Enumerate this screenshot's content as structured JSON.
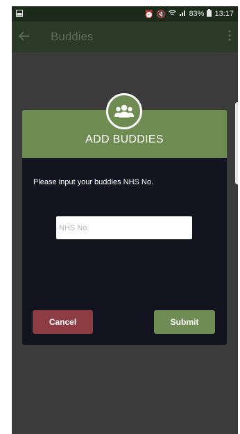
{
  "status_bar": {
    "left_icon": "image-icon",
    "battery": "83%",
    "time": "13:17",
    "icons": [
      "alarm-icon",
      "mute-icon",
      "wifi-icon",
      "signal-icon",
      "battery-icon"
    ]
  },
  "app_bar": {
    "back_icon": "arrow-back-icon",
    "title": "Buddies",
    "menu_icon": "more-vert-icon"
  },
  "dialog": {
    "icon": "group-icon",
    "title": "ADD BUDDIES",
    "prompt": "Please input your buddies NHS No.",
    "input": {
      "placeholder": "NHS No.",
      "value": ""
    },
    "cancel_label": "Cancel",
    "submit_label": "Submit"
  },
  "colors": {
    "header": "#6e8c52",
    "dialog_body": "#131420",
    "cancel": "#8d3c44",
    "submit": "#6f8c55"
  }
}
